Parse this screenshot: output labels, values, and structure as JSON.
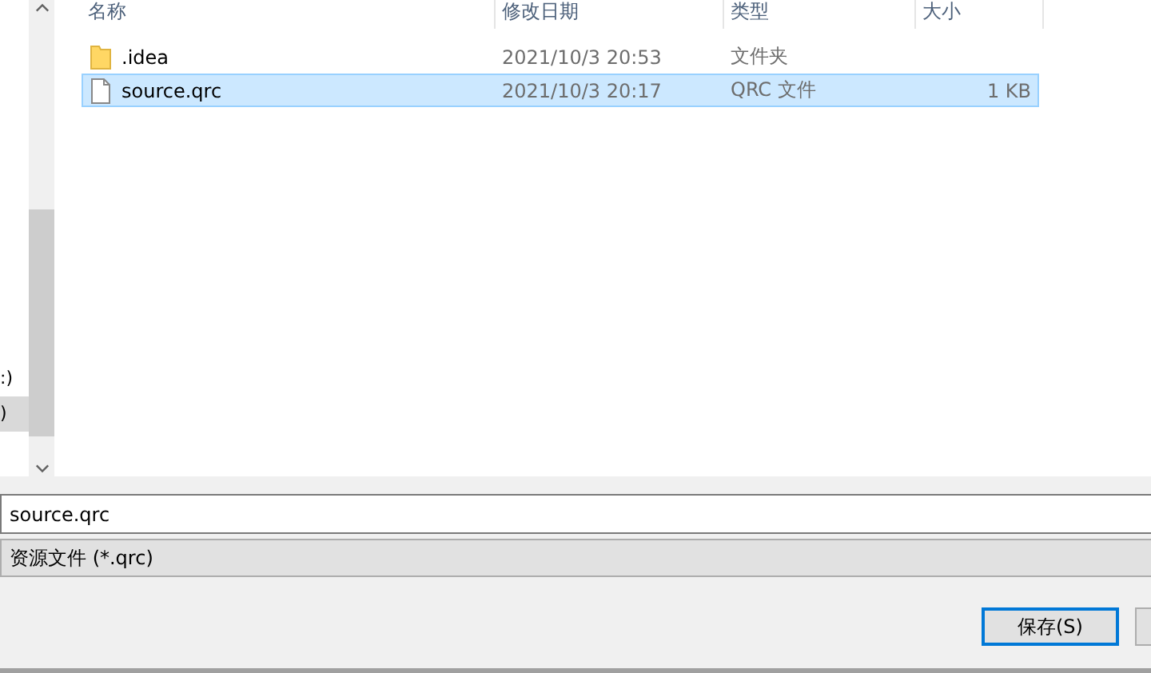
{
  "sidebar": {
    "items": [
      {
        "label": ":)",
        "selected": false
      },
      {
        "label": ")",
        "selected": true
      }
    ]
  },
  "table": {
    "columns": [
      "名称",
      "修改日期",
      "类型",
      "大小"
    ],
    "rows": [
      {
        "kind": "folder",
        "name": ".idea",
        "modified": "2021/10/3 20:53",
        "type": "文件夹",
        "size": "",
        "selected": false
      },
      {
        "kind": "file",
        "name": "source.qrc",
        "modified": "2021/10/3 20:17",
        "type": "QRC 文件",
        "size": "1 KB",
        "selected": true
      }
    ]
  },
  "filename": {
    "value": "source.qrc"
  },
  "filetype": {
    "value": "资源文件 (*.qrc)"
  },
  "buttons": [
    {
      "label": "保存(S)",
      "default": true
    }
  ]
}
